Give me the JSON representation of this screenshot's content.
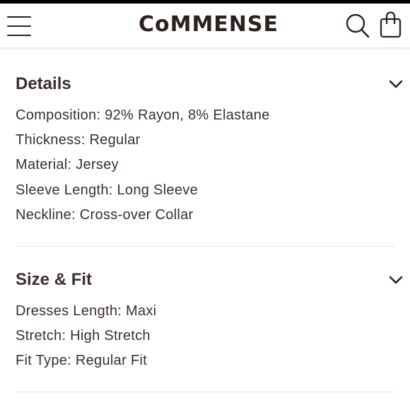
{
  "header": {
    "brand": "CoMMENSE",
    "menu_icon": "hamburger-menu-icon",
    "search_icon": "search-icon",
    "bag_icon": "shopping-bag-icon"
  },
  "sections": [
    {
      "title": "Details",
      "expand_icon": "chevron-down-icon",
      "lines": [
        "Composition: 92% Rayon, 8% Elastane",
        "Thickness: Regular",
        "Material: Jersey",
        "Sleeve Length: Long Sleeve",
        "Neckline: Cross-over Collar"
      ]
    },
    {
      "title": "Size & Fit",
      "expand_icon": "chevron-down-icon",
      "lines": [
        "Dresses Length: Maxi",
        "Stretch: High Stretch",
        "Fit Type: Regular Fit"
      ]
    }
  ],
  "colors": {
    "text": "#3a2f2c",
    "brand": "#2c211f",
    "divider": "#e3e3e3",
    "top_strip": "#000000"
  }
}
